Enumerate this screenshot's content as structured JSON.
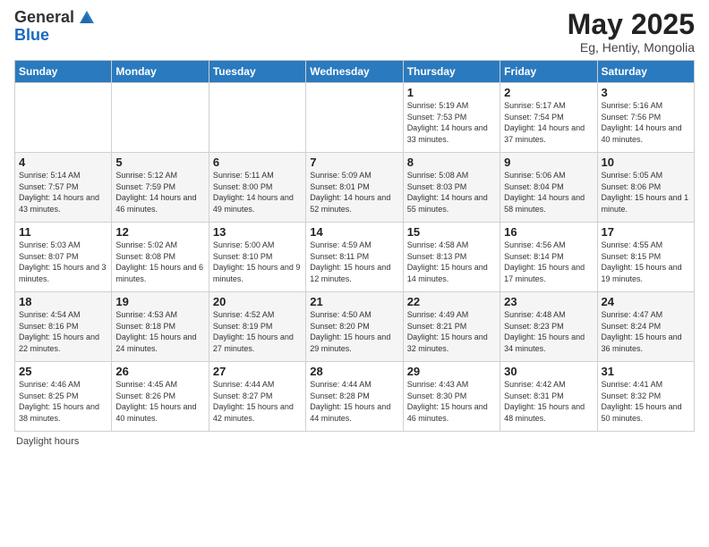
{
  "header": {
    "logo_general": "General",
    "logo_blue": "Blue",
    "title": "May 2025",
    "subtitle": "Eg, Hentiy, Mongolia"
  },
  "weekdays": [
    "Sunday",
    "Monday",
    "Tuesday",
    "Wednesday",
    "Thursday",
    "Friday",
    "Saturday"
  ],
  "footer": {
    "note": "Daylight hours"
  },
  "weeks": [
    [
      {
        "day": "",
        "sunrise": "",
        "sunset": "",
        "daylight": ""
      },
      {
        "day": "",
        "sunrise": "",
        "sunset": "",
        "daylight": ""
      },
      {
        "day": "",
        "sunrise": "",
        "sunset": "",
        "daylight": ""
      },
      {
        "day": "",
        "sunrise": "",
        "sunset": "",
        "daylight": ""
      },
      {
        "day": "1",
        "sunrise": "Sunrise: 5:19 AM",
        "sunset": "Sunset: 7:53 PM",
        "daylight": "Daylight: 14 hours and 33 minutes."
      },
      {
        "day": "2",
        "sunrise": "Sunrise: 5:17 AM",
        "sunset": "Sunset: 7:54 PM",
        "daylight": "Daylight: 14 hours and 37 minutes."
      },
      {
        "day": "3",
        "sunrise": "Sunrise: 5:16 AM",
        "sunset": "Sunset: 7:56 PM",
        "daylight": "Daylight: 14 hours and 40 minutes."
      }
    ],
    [
      {
        "day": "4",
        "sunrise": "Sunrise: 5:14 AM",
        "sunset": "Sunset: 7:57 PM",
        "daylight": "Daylight: 14 hours and 43 minutes."
      },
      {
        "day": "5",
        "sunrise": "Sunrise: 5:12 AM",
        "sunset": "Sunset: 7:59 PM",
        "daylight": "Daylight: 14 hours and 46 minutes."
      },
      {
        "day": "6",
        "sunrise": "Sunrise: 5:11 AM",
        "sunset": "Sunset: 8:00 PM",
        "daylight": "Daylight: 14 hours and 49 minutes."
      },
      {
        "day": "7",
        "sunrise": "Sunrise: 5:09 AM",
        "sunset": "Sunset: 8:01 PM",
        "daylight": "Daylight: 14 hours and 52 minutes."
      },
      {
        "day": "8",
        "sunrise": "Sunrise: 5:08 AM",
        "sunset": "Sunset: 8:03 PM",
        "daylight": "Daylight: 14 hours and 55 minutes."
      },
      {
        "day": "9",
        "sunrise": "Sunrise: 5:06 AM",
        "sunset": "Sunset: 8:04 PM",
        "daylight": "Daylight: 14 hours and 58 minutes."
      },
      {
        "day": "10",
        "sunrise": "Sunrise: 5:05 AM",
        "sunset": "Sunset: 8:06 PM",
        "daylight": "Daylight: 15 hours and 1 minute."
      }
    ],
    [
      {
        "day": "11",
        "sunrise": "Sunrise: 5:03 AM",
        "sunset": "Sunset: 8:07 PM",
        "daylight": "Daylight: 15 hours and 3 minutes."
      },
      {
        "day": "12",
        "sunrise": "Sunrise: 5:02 AM",
        "sunset": "Sunset: 8:08 PM",
        "daylight": "Daylight: 15 hours and 6 minutes."
      },
      {
        "day": "13",
        "sunrise": "Sunrise: 5:00 AM",
        "sunset": "Sunset: 8:10 PM",
        "daylight": "Daylight: 15 hours and 9 minutes."
      },
      {
        "day": "14",
        "sunrise": "Sunrise: 4:59 AM",
        "sunset": "Sunset: 8:11 PM",
        "daylight": "Daylight: 15 hours and 12 minutes."
      },
      {
        "day": "15",
        "sunrise": "Sunrise: 4:58 AM",
        "sunset": "Sunset: 8:13 PM",
        "daylight": "Daylight: 15 hours and 14 minutes."
      },
      {
        "day": "16",
        "sunrise": "Sunrise: 4:56 AM",
        "sunset": "Sunset: 8:14 PM",
        "daylight": "Daylight: 15 hours and 17 minutes."
      },
      {
        "day": "17",
        "sunrise": "Sunrise: 4:55 AM",
        "sunset": "Sunset: 8:15 PM",
        "daylight": "Daylight: 15 hours and 19 minutes."
      }
    ],
    [
      {
        "day": "18",
        "sunrise": "Sunrise: 4:54 AM",
        "sunset": "Sunset: 8:16 PM",
        "daylight": "Daylight: 15 hours and 22 minutes."
      },
      {
        "day": "19",
        "sunrise": "Sunrise: 4:53 AM",
        "sunset": "Sunset: 8:18 PM",
        "daylight": "Daylight: 15 hours and 24 minutes."
      },
      {
        "day": "20",
        "sunrise": "Sunrise: 4:52 AM",
        "sunset": "Sunset: 8:19 PM",
        "daylight": "Daylight: 15 hours and 27 minutes."
      },
      {
        "day": "21",
        "sunrise": "Sunrise: 4:50 AM",
        "sunset": "Sunset: 8:20 PM",
        "daylight": "Daylight: 15 hours and 29 minutes."
      },
      {
        "day": "22",
        "sunrise": "Sunrise: 4:49 AM",
        "sunset": "Sunset: 8:21 PM",
        "daylight": "Daylight: 15 hours and 32 minutes."
      },
      {
        "day": "23",
        "sunrise": "Sunrise: 4:48 AM",
        "sunset": "Sunset: 8:23 PM",
        "daylight": "Daylight: 15 hours and 34 minutes."
      },
      {
        "day": "24",
        "sunrise": "Sunrise: 4:47 AM",
        "sunset": "Sunset: 8:24 PM",
        "daylight": "Daylight: 15 hours and 36 minutes."
      }
    ],
    [
      {
        "day": "25",
        "sunrise": "Sunrise: 4:46 AM",
        "sunset": "Sunset: 8:25 PM",
        "daylight": "Daylight: 15 hours and 38 minutes."
      },
      {
        "day": "26",
        "sunrise": "Sunrise: 4:45 AM",
        "sunset": "Sunset: 8:26 PM",
        "daylight": "Daylight: 15 hours and 40 minutes."
      },
      {
        "day": "27",
        "sunrise": "Sunrise: 4:44 AM",
        "sunset": "Sunset: 8:27 PM",
        "daylight": "Daylight: 15 hours and 42 minutes."
      },
      {
        "day": "28",
        "sunrise": "Sunrise: 4:44 AM",
        "sunset": "Sunset: 8:28 PM",
        "daylight": "Daylight: 15 hours and 44 minutes."
      },
      {
        "day": "29",
        "sunrise": "Sunrise: 4:43 AM",
        "sunset": "Sunset: 8:30 PM",
        "daylight": "Daylight: 15 hours and 46 minutes."
      },
      {
        "day": "30",
        "sunrise": "Sunrise: 4:42 AM",
        "sunset": "Sunset: 8:31 PM",
        "daylight": "Daylight: 15 hours and 48 minutes."
      },
      {
        "day": "31",
        "sunrise": "Sunrise: 4:41 AM",
        "sunset": "Sunset: 8:32 PM",
        "daylight": "Daylight: 15 hours and 50 minutes."
      }
    ]
  ]
}
